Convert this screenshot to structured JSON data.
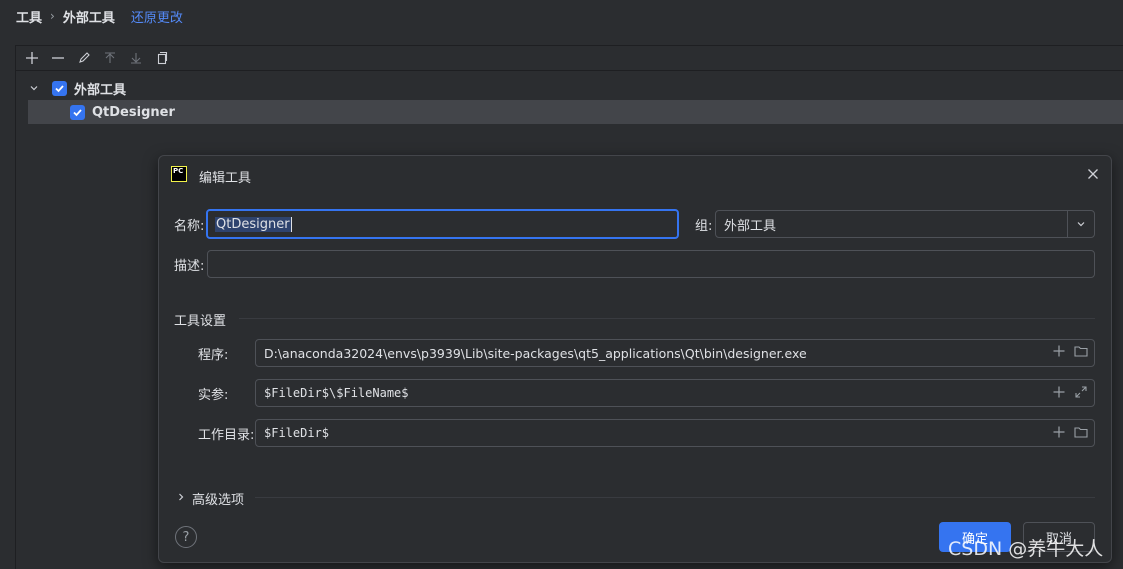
{
  "breadcrumb": {
    "root": "工具",
    "current": "外部工具",
    "revert_link": "还原更改"
  },
  "tree": {
    "group_label": "外部工具",
    "item_label": "QtDesigner"
  },
  "dialog": {
    "title": "编辑工具",
    "logo_text": "PC",
    "name_label": "名称:",
    "name_value": "QtDesigner",
    "group_label": "组:",
    "group_value": "外部工具",
    "desc_label": "描述:",
    "desc_value": "",
    "tool_settings_header": "工具设置",
    "program_label": "程序:",
    "program_value": "D:\\anaconda32024\\envs\\p3939\\Lib\\site-packages\\qt5_applications\\Qt\\bin\\designer.exe",
    "args_label": "实参:",
    "args_value": "$FileDir$\\$FileName$",
    "workdir_label": "工作目录:",
    "workdir_value": "$FileDir$",
    "advanced_label": "高级选项",
    "ok_label": "确定",
    "cancel_label": "取消",
    "help_label": "?"
  },
  "watermark": "CSDN @养牛大人",
  "colors": {
    "accent": "#3574f0",
    "link": "#548af7",
    "background": "#2b2d30"
  }
}
